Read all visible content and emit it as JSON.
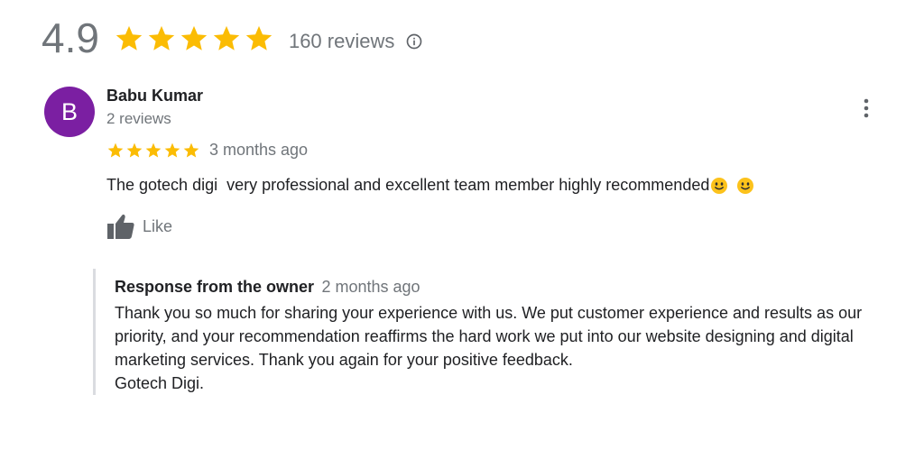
{
  "summary": {
    "rating": "4.9",
    "stars": 5,
    "review_count": "160 reviews",
    "info_icon": "info-icon"
  },
  "review": {
    "avatar_letter": "B",
    "reviewer_name": "Babu Kumar",
    "reviewer_meta": "2 reviews",
    "stars": 5,
    "date": "3 months ago",
    "text": "The gotech digi  very professional and excellent team member highly recommended",
    "emojis": [
      "slightly-smiling-face",
      "slightly-smiling-face"
    ],
    "like_label": "Like",
    "more_icon": "more-vert-icon"
  },
  "owner_response": {
    "title": "Response from the owner",
    "date": "2 months ago",
    "lines": [
      "Thank you so much for sharing your experience with us. We put customer experience and results as our",
      "priority, and your recommendation reaffirms the hard work we put into our website designing and digital",
      "marketing services. Thank you again for your positive feedback.",
      "Gotech Digi."
    ]
  },
  "colors": {
    "star": "#fbbc04",
    "avatar_bg": "#7b1fa2",
    "muted_text": "#70757a",
    "primary_text": "#202124",
    "response_border": "#dadce0"
  }
}
